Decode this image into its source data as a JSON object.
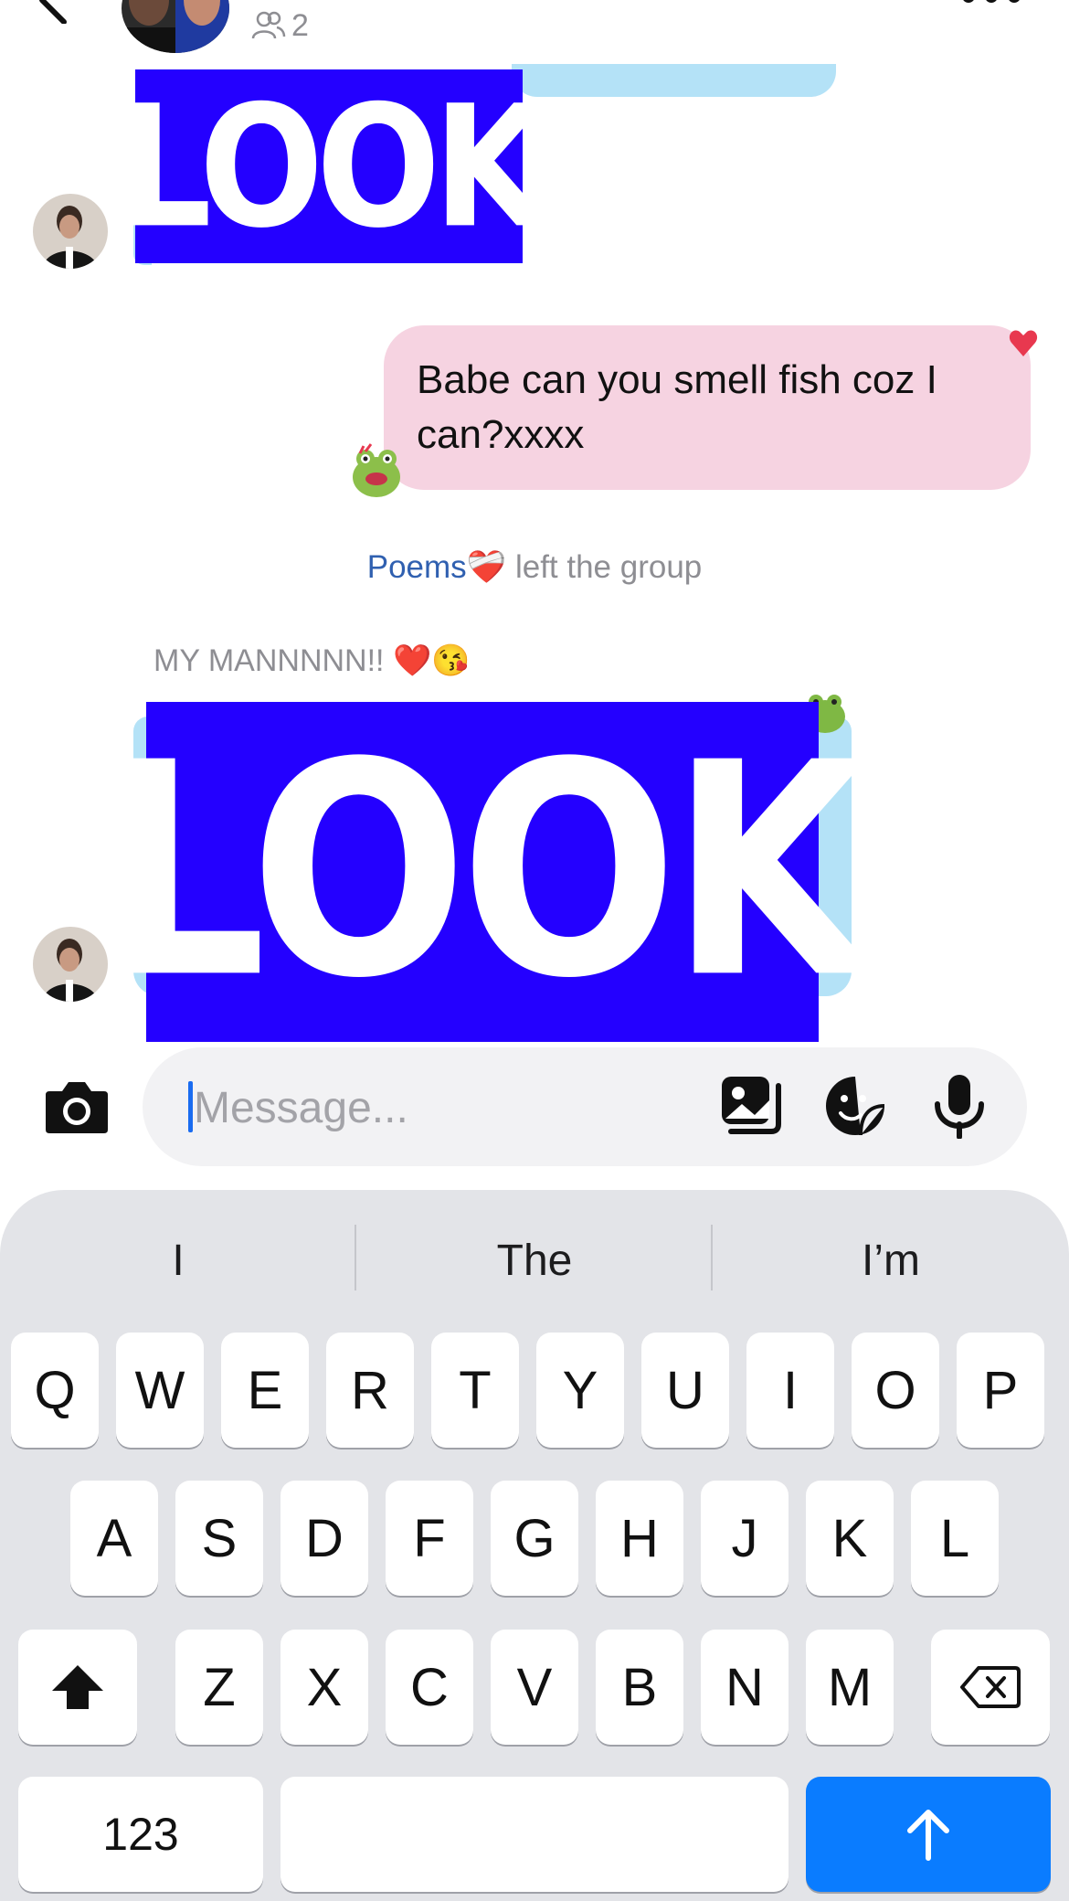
{
  "header": {
    "member_count": "2"
  },
  "messages": {
    "sticker_top_text": "LOOK",
    "outgoing_text": "Babe can you smell fish coz I can?xxxx",
    "system_name": "Poems❤️‍🩹",
    "system_action": " left the group",
    "reply_label": "MY MANNNNN!! ❤️😘",
    "sticker_bottom_text": "LOOK"
  },
  "composer": {
    "placeholder": "Message..."
  },
  "keyboard": {
    "suggestions": [
      "I",
      "The",
      "I’m"
    ],
    "row1": [
      "Q",
      "W",
      "E",
      "R",
      "T",
      "Y",
      "U",
      "I",
      "O",
      "P"
    ],
    "row2": [
      "A",
      "S",
      "D",
      "F",
      "G",
      "H",
      "J",
      "K",
      "L"
    ],
    "row3": [
      "Z",
      "X",
      "C",
      "V",
      "B",
      "N",
      "M"
    ],
    "numbers_key": "123"
  },
  "colors": {
    "accent_blue": "#0a7cff",
    "sticker_blue": "#2400ff",
    "pink_bubble": "#f6d3e1",
    "light_blue_bubble": "#b4e2f7"
  },
  "icons": [
    "back-arrow-icon",
    "members-icon",
    "more-icon",
    "heart-icon",
    "camera-icon",
    "gallery-icon",
    "sticker-icon",
    "mic-icon",
    "shift-icon",
    "backspace-icon",
    "send-arrow-icon"
  ]
}
